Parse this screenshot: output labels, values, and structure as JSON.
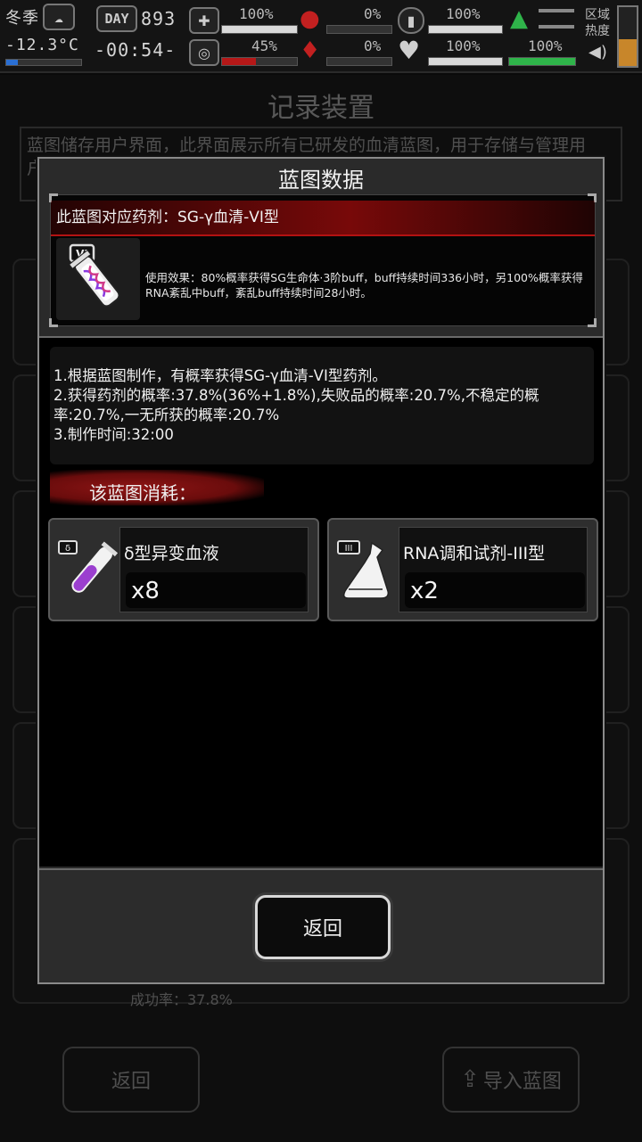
{
  "status_bar": {
    "season": "冬季",
    "temperature": "-12.3°C",
    "day_label": "DAY",
    "day_number": "893",
    "time": "-00:54-",
    "stats": [
      {
        "name": "health",
        "value": "100%",
        "fraction": 1.0,
        "color": "#d9d9d9"
      },
      {
        "name": "sanity",
        "value": "45%",
        "fraction": 0.45,
        "color": "#b51818"
      },
      {
        "name": "hunger",
        "value": "0%",
        "fraction": 0.0,
        "color": "#c22020"
      },
      {
        "name": "thirst",
        "value": "0%",
        "fraction": 0.0,
        "color": "#c22020"
      },
      {
        "name": "stamina",
        "value": "100%",
        "fraction": 1.0,
        "color": "#d9d9d9"
      },
      {
        "name": "mood",
        "value": "100%",
        "fraction": 1.0,
        "color": "#d9d9d9"
      },
      {
        "name": "stealth",
        "value": "100%",
        "fraction": 1.0,
        "color": "#2fb44a"
      }
    ],
    "region_heat_label": "区域热度"
  },
  "background": {
    "title": "记录装置",
    "description": "蓝图储存用户界面，此界面展示所有已研发的血清蓝图，用于存储与管理用户…便…",
    "success_rate": "成功率：37.8%",
    "back_label": "返回",
    "import_label": "导入蓝图"
  },
  "modal": {
    "title": "蓝图数据",
    "recipe": {
      "name": "此蓝图对应药剂：SG-γ血清-VI型",
      "icon": "serum-vial-icon",
      "icon_badge": "VI",
      "effect": "使用效果：80%概率获得SG生命体·3阶buff，buff持续时间336小时，另100%概率获得RNA紊乱中buff，紊乱buff持续时间28小时。"
    },
    "info_lines": [
      "1.根据蓝图制作，有概率获得SG-γ血清-VI型药剂。",
      "2.获得药剂的概率:37.8%(36%+1.8%),失败品的概率:20.7%,不稳定的概率:20.7%,一无所获的概率:20.7%",
      "3.制作时间:32:00"
    ],
    "consume_label": "该蓝图消耗：",
    "materials": [
      {
        "name": "δ型异变血液",
        "qty": "x8",
        "icon": "test-tube-icon",
        "badge": "δ"
      },
      {
        "name": "RNA调和试剂-III型",
        "qty": "x2",
        "icon": "flask-icon",
        "badge": "III"
      }
    ],
    "back_button": "返回"
  },
  "colors": {
    "accent_red": "#b31212",
    "panel_dark": "#000000",
    "modal_bg": "#2a2a2a"
  }
}
